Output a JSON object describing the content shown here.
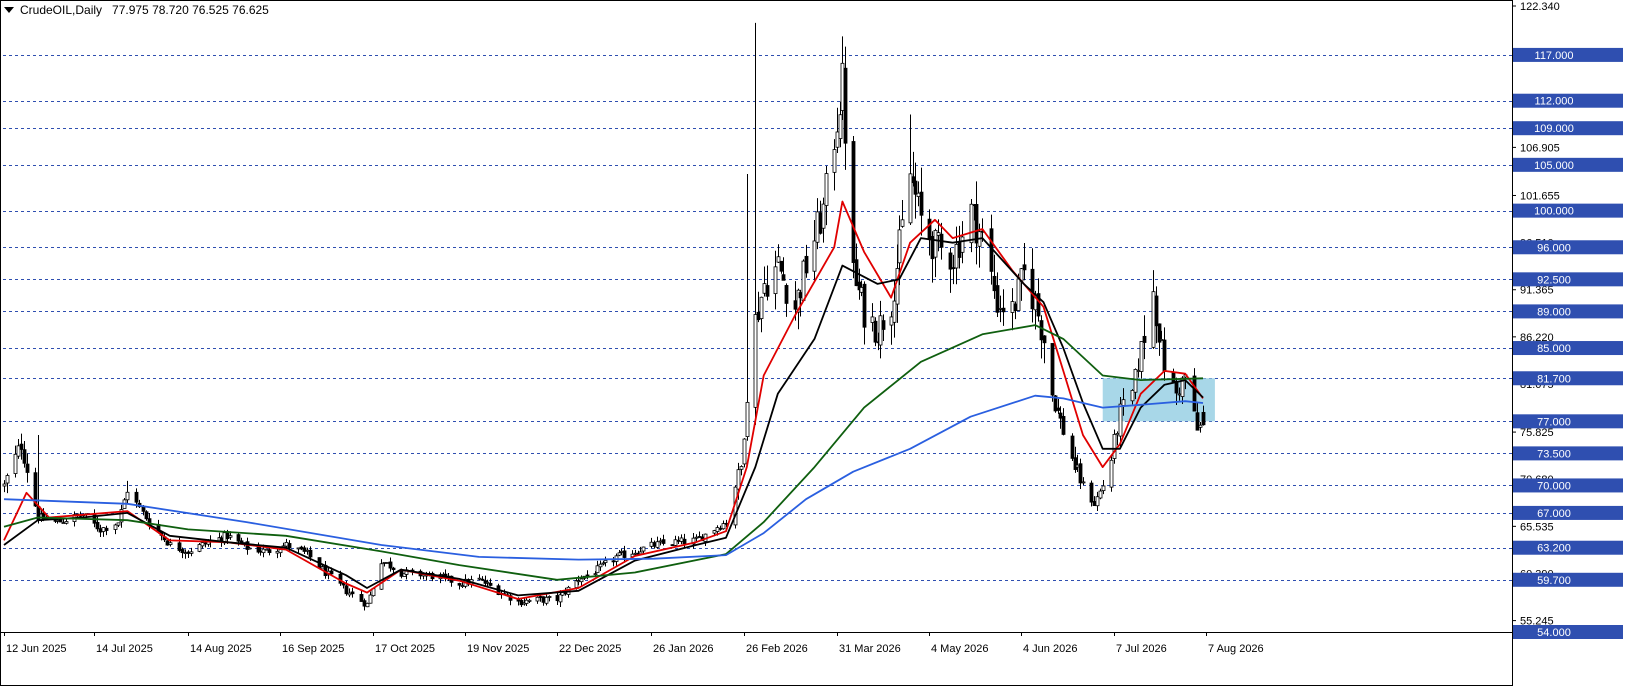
{
  "header": {
    "symbol": "CrudeOIL,Daily",
    "ohlc": "77.975 78.720 76.525 76.625"
  },
  "colors": {
    "grid": "#2f4fb0",
    "price_label_bg": "#2f4fb0",
    "zone": "#9fd3e6",
    "ma_red": "#e00000",
    "ma_black": "#000000",
    "ma_green": "#0f5f0f",
    "ma_blue": "#2a5fe0"
  },
  "chart_data": {
    "type": "candlestick",
    "symbol": "CrudeOIL",
    "timeframe": "Daily",
    "ylim": [
      54.0,
      122.34
    ],
    "y_axis_ticks": [
      122.34,
      106.905,
      101.655,
      96.51,
      91.365,
      86.22,
      81.075,
      75.825,
      70.68,
      65.535,
      60.39,
      55.245
    ],
    "horizontal_levels": [
      117.0,
      112.0,
      109.0,
      105.0,
      100.0,
      96.0,
      92.5,
      89.0,
      85.0,
      81.7,
      77.0,
      73.5,
      70.0,
      67.0,
      63.2,
      59.7,
      54.0
    ],
    "x_tick_labels": [
      "12 Jun 2025",
      "14 Jul 2025",
      "14 Aug 2025",
      "16 Sep 2025",
      "17 Oct 2025",
      "19 Nov 2025",
      "22 Dec 2025",
      "26 Jan 2026",
      "26 Feb 2026",
      "31 Mar 2026",
      "4 May 2026",
      "4 Jun 2026",
      "7 Jul 2026",
      "7 Aug 2026"
    ],
    "zone": {
      "start": "2026-07-03",
      "end": "2026-08-10",
      "low": 77.0,
      "high": 81.7
    },
    "close_path": [
      [
        "2025-06-12",
        70.0
      ],
      [
        "2025-06-18",
        74.5
      ],
      [
        "2025-06-24",
        66.5
      ],
      [
        "2025-07-01",
        66.0
      ],
      [
        "2025-07-10",
        66.8
      ],
      [
        "2025-07-16",
        65.2
      ],
      [
        "2025-07-22",
        66.0
      ],
      [
        "2025-07-25",
        69.5
      ],
      [
        "2025-08-01",
        66.0
      ],
      [
        "2025-08-08",
        63.5
      ],
      [
        "2025-08-14",
        62.8
      ],
      [
        "2025-08-21",
        63.8
      ],
      [
        "2025-08-28",
        64.5
      ],
      [
        "2025-09-04",
        63.2
      ],
      [
        "2025-09-11",
        62.8
      ],
      [
        "2025-09-18",
        63.5
      ],
      [
        "2025-09-25",
        62.5
      ],
      [
        "2025-10-01",
        60.5
      ],
      [
        "2025-10-08",
        58.5
      ],
      [
        "2025-10-15",
        57.0
      ],
      [
        "2025-10-20",
        61.8
      ],
      [
        "2025-10-27",
        60.5
      ],
      [
        "2025-11-03",
        60.3
      ],
      [
        "2025-11-10",
        60.0
      ],
      [
        "2025-11-17",
        59.3
      ],
      [
        "2025-11-24",
        59.7
      ],
      [
        "2025-12-01",
        58.5
      ],
      [
        "2025-12-08",
        57.3
      ],
      [
        "2025-12-15",
        57.5
      ],
      [
        "2025-12-22",
        57.6
      ],
      [
        "2025-12-30",
        59.8
      ],
      [
        "2026-01-06",
        60.8
      ],
      [
        "2026-01-13",
        62.2
      ],
      [
        "2026-01-20",
        62.8
      ],
      [
        "2026-01-27",
        63.5
      ],
      [
        "2026-02-03",
        63.8
      ],
      [
        "2026-02-10",
        64.0
      ],
      [
        "2026-02-17",
        65.5
      ],
      [
        "2026-02-20",
        66.0
      ],
      [
        "2026-02-23",
        70.0
      ],
      [
        "2026-02-25",
        72.0
      ],
      [
        "2026-02-27",
        80.0
      ],
      [
        "2026-03-02",
        88.0
      ],
      [
        "2026-03-05",
        92.0
      ],
      [
        "2026-03-10",
        94.0
      ],
      [
        "2026-03-16",
        89.5
      ],
      [
        "2026-03-20",
        94.0
      ],
      [
        "2026-03-26",
        100.0
      ],
      [
        "2026-03-30",
        108.0
      ],
      [
        "2026-04-02",
        114.0
      ],
      [
        "2026-04-06",
        93.0
      ],
      [
        "2026-04-10",
        89.0
      ],
      [
        "2026-04-15",
        87.0
      ],
      [
        "2026-04-20",
        90.0
      ],
      [
        "2026-04-23",
        96.0
      ],
      [
        "2026-04-27",
        104.0
      ],
      [
        "2026-05-01",
        99.0
      ],
      [
        "2026-05-06",
        96.0
      ],
      [
        "2026-05-12",
        95.0
      ],
      [
        "2026-05-18",
        100.0
      ],
      [
        "2026-05-22",
        97.0
      ],
      [
        "2026-05-27",
        90.0
      ],
      [
        "2026-06-01",
        89.0
      ],
      [
        "2026-06-05",
        93.0
      ],
      [
        "2026-06-09",
        90.0
      ],
      [
        "2026-06-12",
        86.0
      ],
      [
        "2026-06-15",
        80.0
      ],
      [
        "2026-06-19",
        76.0
      ],
      [
        "2026-06-23",
        72.0
      ],
      [
        "2026-06-26",
        70.0
      ],
      [
        "2026-06-30",
        68.0
      ],
      [
        "2026-07-03",
        70.0
      ],
      [
        "2026-07-06",
        73.0
      ],
      [
        "2026-07-09",
        78.0
      ],
      [
        "2026-07-13",
        80.0
      ],
      [
        "2026-07-16",
        85.0
      ],
      [
        "2026-07-20",
        91.0
      ],
      [
        "2026-07-24",
        83.0
      ],
      [
        "2026-07-28",
        80.0
      ],
      [
        "2026-07-31",
        82.0
      ],
      [
        "2026-08-04",
        76.0
      ],
      [
        "2026-08-06",
        76.625
      ]
    ],
    "series": [
      {
        "color": "#e00000",
        "points": [
          [
            "2025-06-12",
            64.0
          ],
          [
            "2025-06-20",
            69.2
          ],
          [
            "2025-06-28",
            66.5
          ],
          [
            "2025-07-10",
            66.8
          ],
          [
            "2025-07-25",
            67.2
          ],
          [
            "2025-08-08",
            64.0
          ],
          [
            "2025-08-28",
            63.8
          ],
          [
            "2025-09-18",
            63.0
          ],
          [
            "2025-10-08",
            59.3
          ],
          [
            "2025-10-15",
            58.3
          ],
          [
            "2025-10-27",
            60.8
          ],
          [
            "2025-11-17",
            59.6
          ],
          [
            "2025-12-08",
            57.6
          ],
          [
            "2025-12-30",
            58.8
          ],
          [
            "2026-01-20",
            62.3
          ],
          [
            "2026-02-10",
            63.8
          ],
          [
            "2026-02-20",
            65.0
          ],
          [
            "2026-02-27",
            72.0
          ],
          [
            "2026-03-05",
            82.0
          ],
          [
            "2026-03-16",
            88.5
          ],
          [
            "2026-03-30",
            96.0
          ],
          [
            "2026-04-02",
            101.0
          ],
          [
            "2026-04-10",
            95.5
          ],
          [
            "2026-04-20",
            90.5
          ],
          [
            "2026-04-27",
            96.5
          ],
          [
            "2026-05-06",
            99.0
          ],
          [
            "2026-05-12",
            97.0
          ],
          [
            "2026-05-22",
            98.0
          ],
          [
            "2026-06-01",
            93.5
          ],
          [
            "2026-06-12",
            89.5
          ],
          [
            "2026-06-19",
            82.5
          ],
          [
            "2026-06-26",
            75.5
          ],
          [
            "2026-07-03",
            72.0
          ],
          [
            "2026-07-09",
            74.5
          ],
          [
            "2026-07-16",
            80.0
          ],
          [
            "2026-07-24",
            82.5
          ],
          [
            "2026-07-31",
            82.2
          ],
          [
            "2026-08-06",
            79.5
          ]
        ]
      },
      {
        "color": "#000000",
        "points": [
          [
            "2025-06-12",
            63.5
          ],
          [
            "2025-06-24",
            66.2
          ],
          [
            "2025-07-10",
            66.5
          ],
          [
            "2025-07-25",
            67.0
          ],
          [
            "2025-08-08",
            64.5
          ],
          [
            "2025-08-28",
            63.8
          ],
          [
            "2025-09-18",
            63.2
          ],
          [
            "2025-10-08",
            60.2
          ],
          [
            "2025-10-15",
            58.8
          ],
          [
            "2025-10-27",
            60.8
          ],
          [
            "2025-11-17",
            59.8
          ],
          [
            "2025-12-08",
            58.0
          ],
          [
            "2025-12-30",
            58.5
          ],
          [
            "2026-01-20",
            61.8
          ],
          [
            "2026-02-10",
            63.5
          ],
          [
            "2026-02-20",
            64.3
          ],
          [
            "2026-03-02",
            72.0
          ],
          [
            "2026-03-10",
            80.0
          ],
          [
            "2026-03-23",
            86.0
          ],
          [
            "2026-04-02",
            94.0
          ],
          [
            "2026-04-15",
            92.0
          ],
          [
            "2026-04-23",
            92.5
          ],
          [
            "2026-05-01",
            97.0
          ],
          [
            "2026-05-12",
            96.5
          ],
          [
            "2026-05-22",
            97.0
          ],
          [
            "2026-06-05",
            92.0
          ],
          [
            "2026-06-12",
            90.0
          ],
          [
            "2026-06-19",
            85.0
          ],
          [
            "2026-06-26",
            79.0
          ],
          [
            "2026-07-03",
            74.0
          ],
          [
            "2026-07-09",
            74.0
          ],
          [
            "2026-07-16",
            78.5
          ],
          [
            "2026-07-24",
            81.0
          ],
          [
            "2026-07-31",
            81.5
          ],
          [
            "2026-08-06",
            79.6
          ]
        ]
      },
      {
        "color": "#0f5f0f",
        "points": [
          [
            "2025-06-12",
            65.5
          ],
          [
            "2025-06-24",
            66.5
          ],
          [
            "2025-07-25",
            66.2
          ],
          [
            "2025-08-14",
            65.2
          ],
          [
            "2025-09-18",
            64.5
          ],
          [
            "2025-10-20",
            62.8
          ],
          [
            "2025-11-17",
            61.3
          ],
          [
            "2025-12-22",
            59.7
          ],
          [
            "2026-01-20",
            60.5
          ],
          [
            "2026-02-20",
            62.5
          ],
          [
            "2026-03-05",
            66.0
          ],
          [
            "2026-03-23",
            72.0
          ],
          [
            "2026-04-10",
            78.5
          ],
          [
            "2026-05-01",
            83.5
          ],
          [
            "2026-05-22",
            86.5
          ],
          [
            "2026-06-09",
            87.5
          ],
          [
            "2026-06-19",
            86.0
          ],
          [
            "2026-07-03",
            82.0
          ],
          [
            "2026-07-16",
            81.5
          ],
          [
            "2026-08-06",
            81.7
          ]
        ]
      },
      {
        "color": "#2a5fe0",
        "points": [
          [
            "2025-06-12",
            68.5
          ],
          [
            "2025-07-25",
            68.0
          ],
          [
            "2025-09-04",
            66.0
          ],
          [
            "2025-10-20",
            63.5
          ],
          [
            "2025-11-24",
            62.2
          ],
          [
            "2025-12-30",
            61.9
          ],
          [
            "2026-01-27",
            62.0
          ],
          [
            "2026-02-20",
            62.4
          ],
          [
            "2026-03-05",
            64.8
          ],
          [
            "2026-03-20",
            68.5
          ],
          [
            "2026-04-06",
            71.5
          ],
          [
            "2026-04-27",
            74.0
          ],
          [
            "2026-05-18",
            77.5
          ],
          [
            "2026-06-09",
            79.8
          ],
          [
            "2026-06-19",
            79.5
          ],
          [
            "2026-07-03",
            78.5
          ],
          [
            "2026-07-16",
            78.8
          ],
          [
            "2026-07-31",
            79.2
          ],
          [
            "2026-08-06",
            79.0
          ]
        ]
      }
    ]
  }
}
